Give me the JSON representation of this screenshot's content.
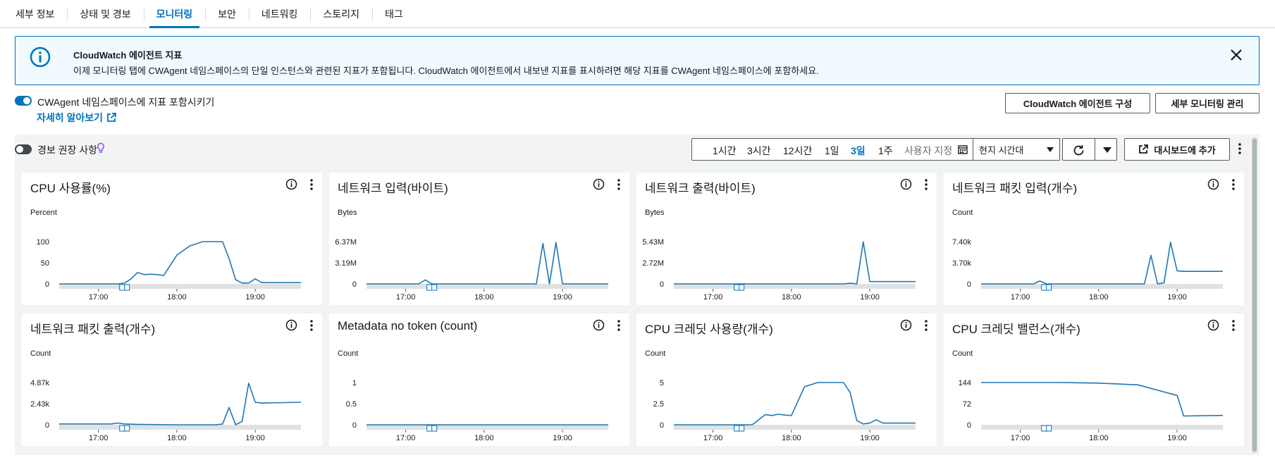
{
  "tabs": [
    {
      "label": "세부 정보"
    },
    {
      "label": "상태 및 경보"
    },
    {
      "label": "모니터링",
      "active": true
    },
    {
      "label": "보안"
    },
    {
      "label": "네트워킹"
    },
    {
      "label": "스토리지"
    },
    {
      "label": "태그"
    }
  ],
  "banner": {
    "title": "CloudWatch 에이전트 지표",
    "text": "이제 모니터링 탭에 CWAgent 네임스페이스의 단일 인스턴스와 관련된 지표가 포함됩니다. CloudWatch 에이전트에서 내보낸 지표를 표시하려면 해당 지표를 CWAgent 네임스페이스에 포함하세요."
  },
  "cwagent": {
    "toggle_label": "CWAgent 네임스페이스에 지표 포함시키기",
    "learn_more": "자세히 알아보기"
  },
  "buttons": {
    "configure_agent": "CloudWatch 에이전트 구성",
    "manage_monitoring": "세부 모니터링 관리",
    "add_dashboard": "대시보드에 추가"
  },
  "alarm": {
    "label": "경보 권장 사항"
  },
  "time_range": {
    "options": [
      "1시간",
      "3시간",
      "12시간",
      "1일",
      "3일",
      "1주"
    ],
    "selected": "3일",
    "custom": "사용자 지정",
    "timezone": "현지 시간대"
  },
  "colors": {
    "accent": "#0073bb",
    "line": "#1f77b4"
  },
  "chart_data": [
    {
      "type": "line",
      "title": "CPU 사용률(%)",
      "ylabel": "Percent",
      "yticks": [
        "100",
        "50",
        "0"
      ],
      "ylim": [
        0,
        100
      ],
      "xticks": [
        "17:00",
        "18:00",
        "19:00"
      ],
      "x": [
        "16:30",
        "16:50",
        "17:10",
        "17:15",
        "17:20",
        "17:25",
        "17:30",
        "17:35",
        "17:40",
        "17:45",
        "17:50",
        "18:00",
        "18:10",
        "18:20",
        "18:30",
        "18:35",
        "18:40",
        "18:45",
        "18:50",
        "18:55",
        "19:00",
        "19:05",
        "19:10",
        "19:20",
        "19:30",
        "19:35"
      ],
      "values": [
        0,
        0,
        0,
        0,
        2,
        12,
        27,
        22,
        23,
        22,
        20,
        68,
        90,
        100,
        100,
        100,
        60,
        10,
        2,
        2,
        12,
        3,
        3,
        3,
        3,
        3
      ]
    },
    {
      "type": "line",
      "title": "네트워크 입력(바이트)",
      "ylabel": "Bytes",
      "yticks": [
        "6.37M",
        "3.19M",
        "0"
      ],
      "ylim": [
        0,
        6370000
      ],
      "xticks": [
        "17:00",
        "18:00",
        "19:00"
      ],
      "x": [
        "16:30",
        "17:00",
        "17:10",
        "17:15",
        "17:20",
        "17:25",
        "17:30",
        "18:00",
        "18:30",
        "18:40",
        "18:45",
        "18:50",
        "18:55",
        "19:00",
        "19:05",
        "19:35"
      ],
      "values": [
        0,
        0,
        0,
        600000,
        0,
        0,
        0,
        0,
        0,
        0,
        6100000,
        0,
        6250000,
        0,
        0,
        0
      ]
    },
    {
      "type": "line",
      "title": "네트워크 출력(바이트)",
      "ylabel": "Bytes",
      "yticks": [
        "5.43M",
        "2.72M",
        "0"
      ],
      "ylim": [
        0,
        5430000
      ],
      "xticks": [
        "17:00",
        "18:00",
        "19:00"
      ],
      "x": [
        "16:30",
        "17:00",
        "17:30",
        "18:00",
        "18:30",
        "18:40",
        "18:45",
        "18:50",
        "18:55",
        "19:00",
        "19:05",
        "19:35"
      ],
      "values": [
        0,
        0,
        0,
        0,
        0,
        0,
        100000,
        0,
        5400000,
        300000,
        300000,
        300000
      ]
    },
    {
      "type": "line",
      "title": "네트워크 패킷 입력(개수)",
      "ylabel": "Count",
      "yticks": [
        "7.40k",
        "3.70k",
        "0"
      ],
      "ylim": [
        0,
        7400
      ],
      "xticks": [
        "17:00",
        "18:00",
        "19:00"
      ],
      "x": [
        "16:30",
        "17:00",
        "17:10",
        "17:15",
        "17:20",
        "17:25",
        "17:30",
        "18:00",
        "18:30",
        "18:35",
        "18:40",
        "18:45",
        "18:50",
        "18:55",
        "19:00",
        "19:05",
        "19:35"
      ],
      "values": [
        0,
        0,
        0,
        500,
        0,
        0,
        0,
        0,
        0,
        0,
        5000,
        0,
        200,
        7300,
        2300,
        2200,
        2200
      ]
    },
    {
      "type": "line",
      "title": "네트워크 패킷 출력(개수)",
      "ylabel": "Count",
      "yticks": [
        "4.87k",
        "2.43k",
        "0"
      ],
      "ylim": [
        0,
        4870
      ],
      "xticks": [
        "17:00",
        "18:00",
        "19:00"
      ],
      "x": [
        "16:30",
        "17:00",
        "17:10",
        "17:15",
        "17:20",
        "17:30",
        "18:00",
        "18:30",
        "18:35",
        "18:40",
        "18:45",
        "18:50",
        "18:55",
        "19:00",
        "19:05",
        "19:35"
      ],
      "values": [
        100,
        100,
        100,
        200,
        100,
        50,
        0,
        0,
        100,
        2000,
        0,
        400,
        4800,
        2600,
        2500,
        2600
      ]
    },
    {
      "type": "line",
      "title": "Metadata no token (count)",
      "ylabel": "Count",
      "yticks": [
        "1",
        "0.5",
        "0"
      ],
      "ylim": [
        0,
        1
      ],
      "xticks": [
        "17:00",
        "18:00",
        "19:00"
      ],
      "x": [
        "16:30",
        "19:35"
      ],
      "values": [
        0,
        0
      ]
    },
    {
      "type": "line",
      "title": "CPU 크레딧 사용량(개수)",
      "ylabel": "Count",
      "yticks": [
        "5",
        "2.5",
        "0"
      ],
      "ylim": [
        0,
        5
      ],
      "xticks": [
        "17:00",
        "18:00",
        "19:00"
      ],
      "x": [
        "16:30",
        "17:00",
        "17:20",
        "17:30",
        "17:40",
        "17:45",
        "17:50",
        "17:55",
        "18:00",
        "18:10",
        "18:20",
        "18:30",
        "18:35",
        "18:40",
        "18:45",
        "18:50",
        "18:55",
        "19:00",
        "19:05",
        "19:10",
        "19:20",
        "19:35"
      ],
      "values": [
        0,
        0,
        0,
        0,
        1.2,
        1.1,
        1.25,
        1.15,
        1.1,
        4.5,
        5,
        5,
        5,
        5,
        3.8,
        0.5,
        0.1,
        0.2,
        0.6,
        0.2,
        0.2,
        0.2
      ]
    },
    {
      "type": "line",
      "title": "CPU 크레딧 밸런스(개수)",
      "ylabel": "Count",
      "yticks": [
        "144",
        "72",
        "0"
      ],
      "ylim": [
        0,
        144
      ],
      "xticks": [
        "17:00",
        "18:00",
        "19:00"
      ],
      "x": [
        "16:30",
        "17:30",
        "18:00",
        "18:30",
        "19:00",
        "19:05",
        "19:35"
      ],
      "values": [
        144,
        144,
        142,
        136,
        100,
        30,
        32
      ]
    }
  ]
}
